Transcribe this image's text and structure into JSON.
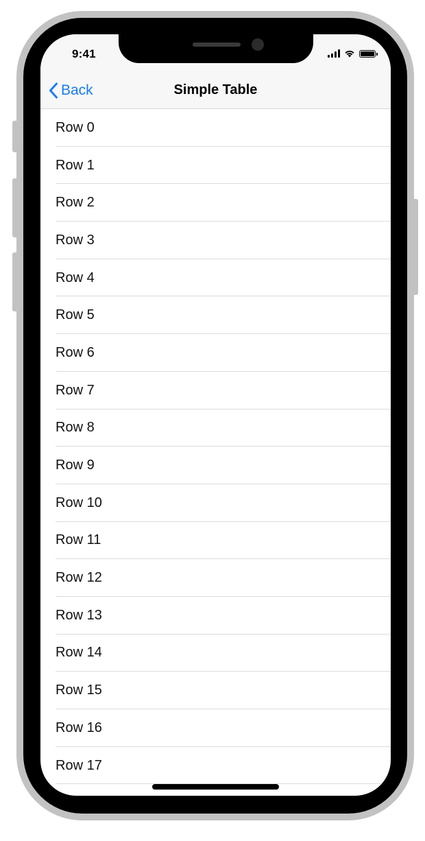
{
  "status_bar": {
    "time": "9:41",
    "icons": [
      "cellular-signal-icon",
      "wifi-icon",
      "battery-icon"
    ]
  },
  "nav": {
    "back_label": "Back",
    "back_icon": "chevron-left-icon",
    "title": "Simple Table"
  },
  "table": {
    "rows": [
      "Row 0",
      "Row 1",
      "Row 2",
      "Row 3",
      "Row 4",
      "Row 5",
      "Row 6",
      "Row 7",
      "Row 8",
      "Row 9",
      "Row 10",
      "Row 11",
      "Row 12",
      "Row 13",
      "Row 14",
      "Row 15",
      "Row 16",
      "Row 17"
    ]
  },
  "colors": {
    "accent": "#1a7cf5",
    "nav_background": "#f7f7f7",
    "separator": "#dcdcde",
    "device_frame": "#c2c2c2"
  }
}
